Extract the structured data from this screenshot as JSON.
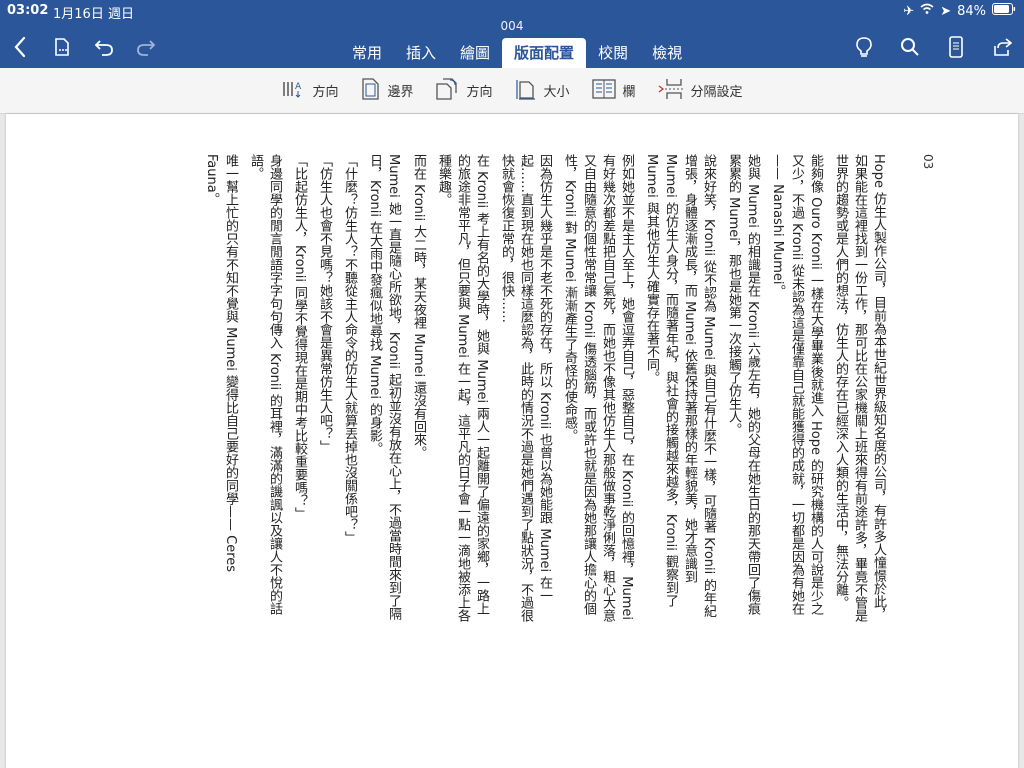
{
  "status": {
    "time": "03:02",
    "date": "1月16日 週日",
    "battery": "84%"
  },
  "document": {
    "title": "004"
  },
  "tabs": [
    {
      "label": "常用",
      "active": false
    },
    {
      "label": "插入",
      "active": false
    },
    {
      "label": "繪圖",
      "active": false
    },
    {
      "label": "版面配置",
      "active": true
    },
    {
      "label": "校閱",
      "active": false
    },
    {
      "label": "檢視",
      "active": false
    }
  ],
  "ribbon": [
    {
      "label": "方向",
      "icon": "text-direction-icon"
    },
    {
      "label": "邊界",
      "icon": "margins-icon"
    },
    {
      "label": "方向",
      "icon": "orientation-icon"
    },
    {
      "label": "大小",
      "icon": "size-icon"
    },
    {
      "label": "欄",
      "icon": "columns-icon"
    },
    {
      "label": "分隔設定",
      "icon": "breaks-icon"
    }
  ],
  "page": {
    "number": "03",
    "paragraphs": [
      "Hope 仿生人製作公司，目前為本世紀世界級知名度的公司，有許多人憧憬於此，如果能在這裡找到一份工作，那可比在公家機關上班來得有前途許多，畢竟不管是世界的趨勢或是人們的想法，仿生人的存在已經深入人類的生活中，無法分離。",
      "能夠像 Ouro Kronii 一樣在大學畢業後就進入 Hope 的研究機構的人可說是少之又少，不過 Kronii 從未認為這是僅靠自己就能獲得的成就，一切都是因為有她在—— Nanashi Mumei。",
      "她與 Mumei 的相識是在 Kronii 六歲左右，她的父母在她生日的那天帶回了傷痕累累的 Mumei，那也是她第一次接觸了仿生人。",
      "說來好笑，Kronii 從不認為 Mumei 與自己有什麼不一樣，可隨著 Kronii 的年紀增張，身體逐漸成長，而 Mumei 依舊保持著那樣的年輕貌美，她才意識到 Mumei 的仿生人身分，而隨著年紀，與社會的接觸越來越多，Kronii 觀察到了 Mumei 與其他仿生人確實存在著不同。",
      "例如她並不是主人至上，她會逗弄自己，惡整自己，在 Kronii 的回憶裡，Mumei 有好幾次都差點把自己氣死，而她也不像其他仿生人那般做事乾淨俐落，粗心大意又自由隨意的個性常常讓 Kronii 傷透腦筋，而或許也就是因為她那讓人擔心的個性，Kronii 對 Mumei 漸漸產生了奇怪的使命感。",
      "因為仿生人幾乎是不老不死的存在，所以 Kronii 也曾以為她能跟 Mumei 在一起……直到現在她也同樣這麼認為，此時的情況不過是她們遇到了點狀況，不過很快就會恢復正常的，很快……",
      "在 Kronii 考上有名的大學時，她與 Mumei 兩人一起離開了偏遠的家鄉，一路上的旅途非常平凡，但只要與 Mumei 在一起，這平凡的日子會一點一滴地被添上各種樂趣。",
      "而在 Kronii 大二時，某天夜裡 Mumei 還沒有回來。",
      "Mumei 她一直是隨心所欲地，Kronii 起初並沒有放在心上，不過當時間來到了隔日，Kronii 在大雨中發瘋似地尋找 Mumei 的身影。",
      "「什麼？仿生人？不聽從主人命令的仿生人就算丟掉也沒關係吧？」",
      "「仿生人也會不見嗎？她該不會是異常仿生人吧？」",
      "「比起仿生人，Kronii 同學不覺得現在是期中考比較重要嗎？」",
      "身邊同學的閒言閒語字字句句傳入 Kronii 的耳裡，滿滿的譏諷以及讓人不悅的話語。",
      "唯一幫上忙的只有不知不覺與 Mumei 變得比自己要好的同學—— Ceres Fauna。"
    ]
  }
}
